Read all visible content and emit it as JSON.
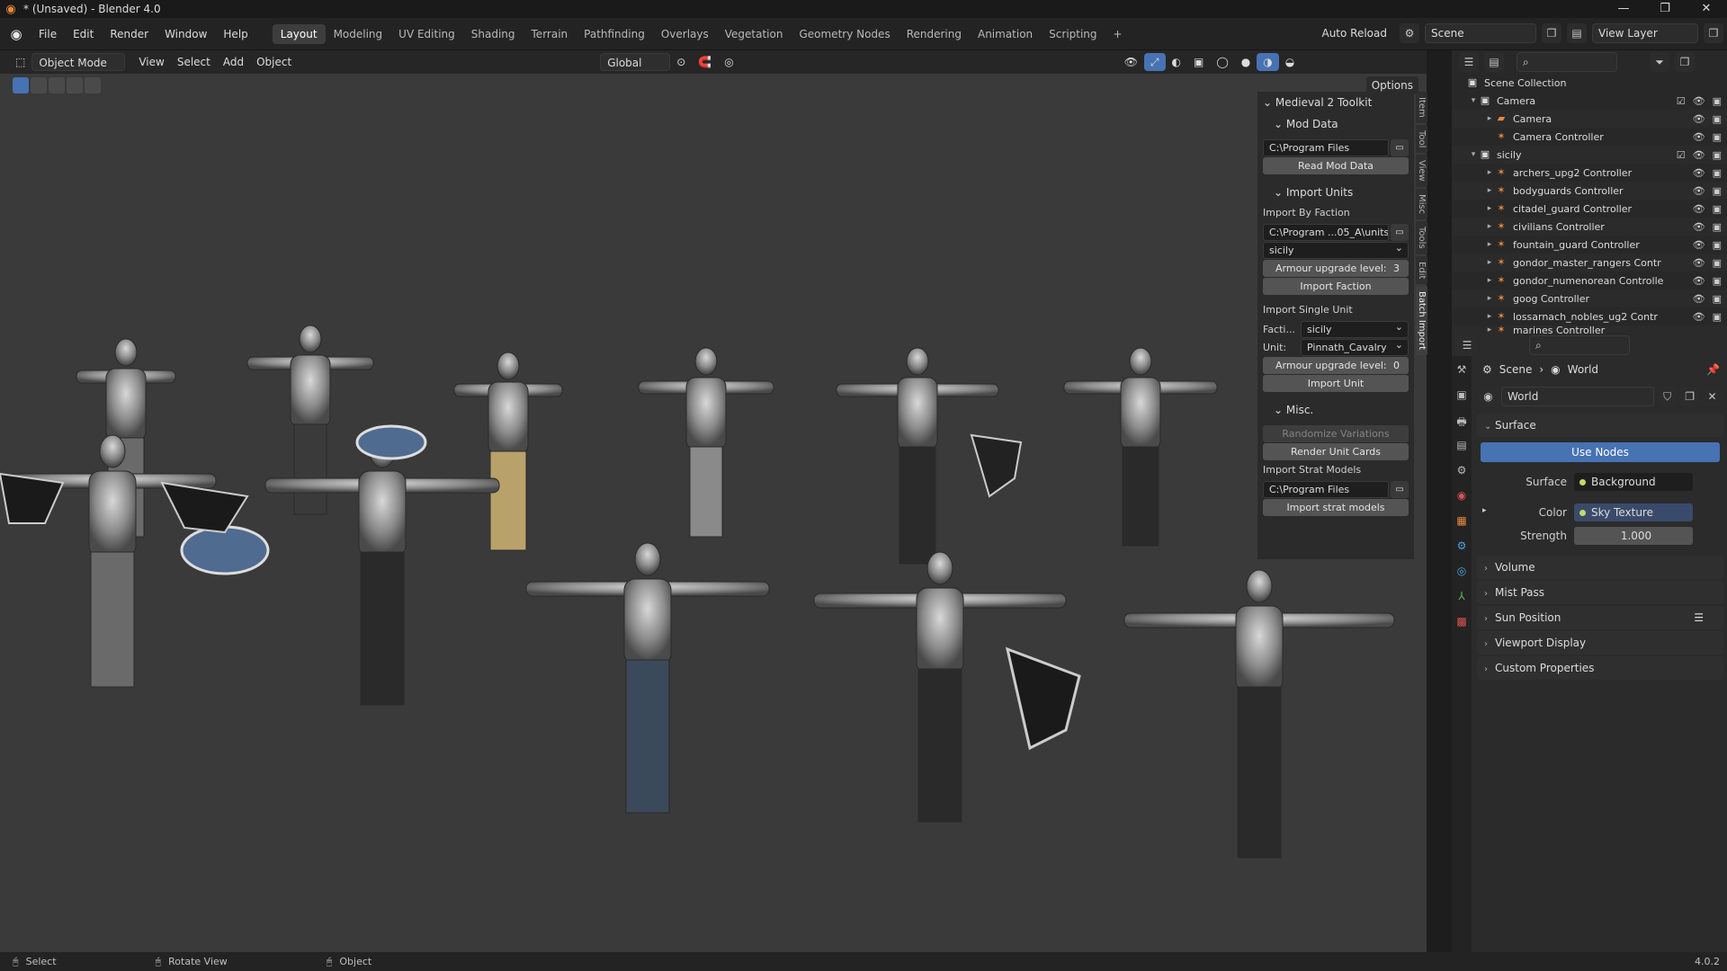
{
  "window": {
    "title": "* (Unsaved) - Blender 4.0",
    "controls": [
      "—",
      "❐",
      "✕"
    ]
  },
  "menu": [
    "File",
    "Edit",
    "Render",
    "Window",
    "Help"
  ],
  "workspaces": [
    "Layout",
    "Modeling",
    "UV Editing",
    "Shading",
    "Terrain",
    "Pathfinding",
    "Overlays",
    "Vegetation",
    "Geometry Nodes",
    "Rendering",
    "Animation",
    "Scripting",
    "+"
  ],
  "topright": {
    "auto_reload": "Auto Reload",
    "scene": "Scene",
    "view_layer": "View Layer"
  },
  "viewport_header": {
    "mode": "Object Mode",
    "menus": [
      "View",
      "Select",
      "Add",
      "Object"
    ],
    "orientation": "Global",
    "options": "Options"
  },
  "npanel": {
    "title": "Medieval 2 Toolkit",
    "mod_data": {
      "header": "Mod Data",
      "path": "C:\\Program Files",
      "button": "Read Mod Data"
    },
    "import_units": {
      "header": "Import Units",
      "by_faction_label": "Import By Faction",
      "path": "C:\\Program ...05_A\\units\\",
      "faction": "sicily",
      "armour_label": "Armour upgrade level:",
      "armour_value": "3",
      "import_faction": "Import Faction",
      "single_label": "Import Single Unit",
      "faction_key": "Facti...",
      "faction_value": "sicily",
      "unit_key": "Unit:",
      "unit_value": "Pinnath_Cavalry",
      "armour_value_single": "0",
      "import_unit": "Import Unit"
    },
    "misc": {
      "header": "Misc.",
      "randomize": "Randomize Variations",
      "render_cards": "Render Unit Cards",
      "strat_label": "Import Strat Models",
      "strat_path": "C:\\Program Files",
      "import_strat": "Import strat models"
    }
  },
  "vtabs": [
    "Item",
    "Tool",
    "View",
    "Misc",
    "Tools",
    "Edit",
    "Batch Import"
  ],
  "outliner": {
    "root": "Scene Collection",
    "rows": [
      {
        "name": "Camera",
        "level": 1,
        "kind": "collection"
      },
      {
        "name": "Camera",
        "level": 2,
        "kind": "camera"
      },
      {
        "name": "Camera Controller",
        "level": 2,
        "kind": "armature"
      },
      {
        "name": "sicily",
        "level": 1,
        "kind": "collection"
      },
      {
        "name": "archers_upg2 Controller",
        "level": 2,
        "kind": "armature"
      },
      {
        "name": "bodyguards Controller",
        "level": 2,
        "kind": "armature"
      },
      {
        "name": "citadel_guard Controller",
        "level": 2,
        "kind": "armature"
      },
      {
        "name": "civilians Controller",
        "level": 2,
        "kind": "armature"
      },
      {
        "name": "fountain_guard Controller",
        "level": 2,
        "kind": "armature"
      },
      {
        "name": "gondor_master_rangers Contr",
        "level": 2,
        "kind": "armature"
      },
      {
        "name": "gondor_numenorean Controlle",
        "level": 2,
        "kind": "armature"
      },
      {
        "name": "goog Controller",
        "level": 2,
        "kind": "armature"
      },
      {
        "name": "lossarnach_nobles_ug2 Contr",
        "level": 2,
        "kind": "armature"
      },
      {
        "name": "marines Controller",
        "level": 2,
        "kind": "armature"
      }
    ]
  },
  "properties": {
    "breadcrumb": [
      "Scene",
      "World"
    ],
    "world_name": "World",
    "sections": {
      "surface": "Surface",
      "use_nodes": "Use Nodes",
      "surface_label": "Surface",
      "surface_value": "Background",
      "color_label": "Color",
      "color_value": "Sky Texture",
      "strength_label": "Strength",
      "strength_value": "1.000",
      "collapsed": [
        "Volume",
        "Mist Pass",
        "Sun Position",
        "Viewport Display",
        "Custom Properties"
      ]
    }
  },
  "statusbar": {
    "left": "Select",
    "middle": "Rotate View",
    "right": "Object",
    "version": "4.0.2"
  },
  "colors": {
    "accent": "#4772b3",
    "orange": "#e8883a",
    "viewport": "#3a3a3a"
  }
}
